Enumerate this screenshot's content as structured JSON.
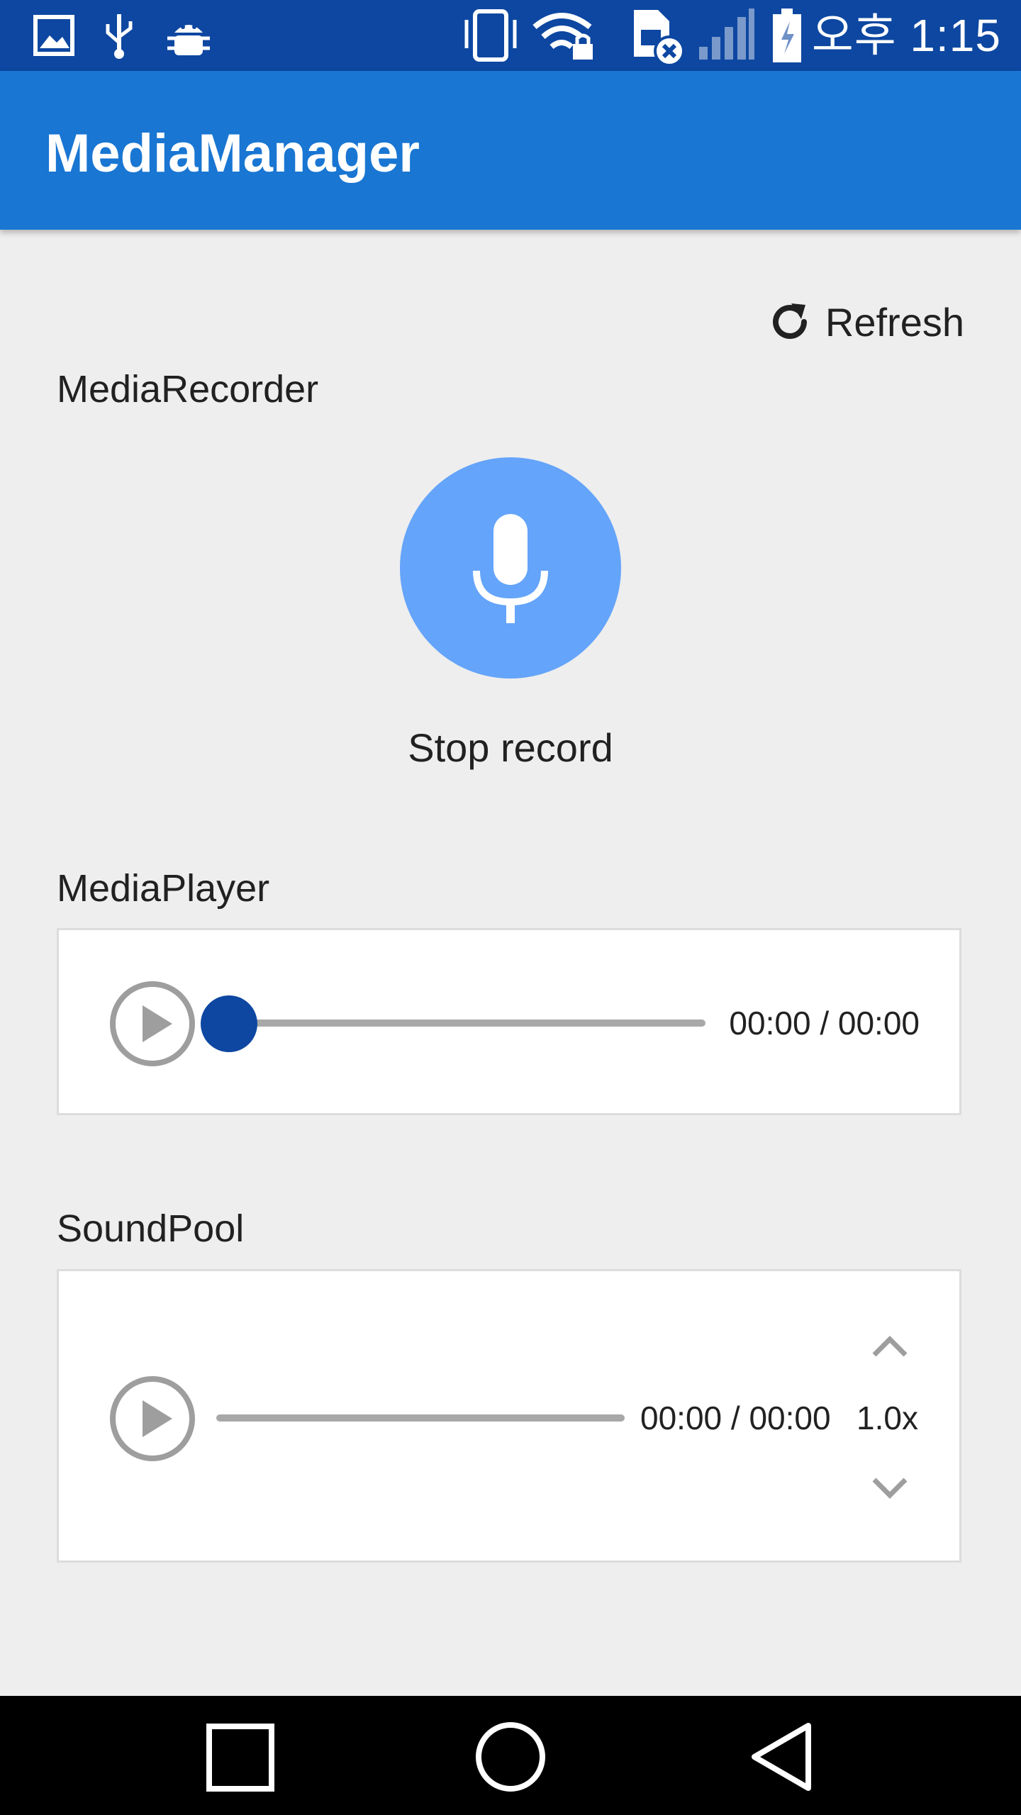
{
  "status_bar": {
    "time": "오후 1:15",
    "icons": [
      "gallery-icon",
      "usb-icon",
      "android-debug-icon",
      "vibrate-icon",
      "wifi-lock-icon",
      "sim-error-icon",
      "signal-icon",
      "battery-charging-icon"
    ]
  },
  "app_bar": {
    "title": "MediaManager"
  },
  "refresh": {
    "label": "Refresh",
    "icon": "refresh-icon"
  },
  "recorder": {
    "title": "MediaRecorder",
    "button_label": "Stop record",
    "icon": "microphone-icon",
    "accent": "#64a4fa"
  },
  "player": {
    "title": "MediaPlayer",
    "time": "00:00 / 00:00",
    "progress": 0
  },
  "soundpool": {
    "title": "SoundPool",
    "time": "00:00 / 00:00",
    "rate": "1.0x",
    "progress": 0
  },
  "nav": {
    "items": [
      "recents-icon",
      "home-icon",
      "back-icon"
    ]
  },
  "colors": {
    "status_bar": "#0d47a1",
    "app_bar": "#1976d2",
    "thumb": "#0d47a1"
  }
}
